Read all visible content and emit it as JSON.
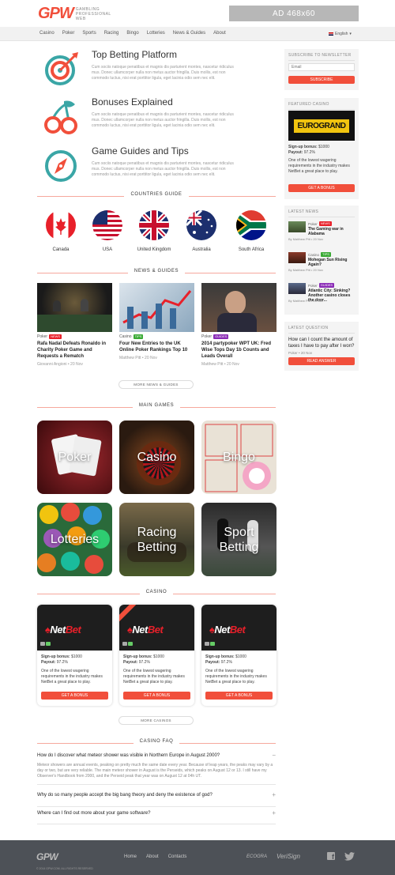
{
  "header": {
    "logo_mark": "GPW",
    "logo_text_lines": [
      "GAMBLING",
      "PROFESSIONAL",
      "WEB"
    ],
    "ad_label": "AD 468x60"
  },
  "nav": {
    "items": [
      "Casino",
      "Poker",
      "Sports",
      "Racing",
      "Bingo",
      "Lotteries",
      "News & Guides",
      "About"
    ],
    "language": "English"
  },
  "features": [
    {
      "title": "Top Betting Platform",
      "icon": "target-icon",
      "text": "Cum sociis natoque penatibus et magnis dis parturient montes, nascetur ridiculus mus. Donec ullamcorper nulla non metus auctor fringilla. Duis mollis, est non commodo luctus, nisi erat porttitor ligula, eget lacinia odio sem nec elit."
    },
    {
      "title": "Bonuses Explained",
      "icon": "cherries-icon",
      "text": "Cum sociis natoque penatibus et magnis dis parturient montes, nascetur ridiculus mus. Donec ullamcorper nulla non metus auctor fringilla. Duis mollis, est non commodo luctus, nisi erat porttitor ligula, eget lacinia odio sem nec elit."
    },
    {
      "title": "Game Guides and Tips",
      "icon": "compass-icon",
      "text": "Cum sociis natoque penatibus et magnis dis parturient montes, nascetur ridiculus mus. Donec ullamcorper nulla non metus auctor fringilla. Duis mollis, est non commodo luctus, nisi erat porttitor ligula, eget lacinia odio sem nec elit."
    }
  ],
  "countries": {
    "heading": "COUNTRIES GUIDE",
    "items": [
      "Canada",
      "USA",
      "United Kingdom",
      "Australia",
      "South Africa"
    ]
  },
  "news": {
    "heading": "NEWS & GUIDES",
    "more_label": "MORE NEWS & GUIDES",
    "items": [
      {
        "category": "Poker",
        "badge": "NEWS",
        "title": "Rafa Nadal Defeats Ronaldo in Charity Poker Game and Requests a Rematch",
        "byline": "Giovanni Angioni • 20 Nov"
      },
      {
        "category": "Casino",
        "badge": "TIPS",
        "title": "Four New Entries to the UK Online Poker Rankings Top 10",
        "byline": "Matthew Pitt • 20 Nov"
      },
      {
        "category": "Poker",
        "badge": "GUIDES",
        "title": "2014 partypoker WPT UK: Fred Wise Tops Day 1b Counts and Leads Overall",
        "byline": "Matthew Pitt • 20 Nov"
      }
    ]
  },
  "games": {
    "heading": "MAIN GAMES",
    "items": [
      "Poker",
      "Casino",
      "Bingo",
      "Lotteries",
      "Racing Betting",
      "Sport Betting"
    ]
  },
  "casino": {
    "heading": "CASINO",
    "more_label": "MORE CASINOS",
    "cards": [
      {
        "brand_a": "Net",
        "brand_b": "Bet",
        "bonus_label": "Sign-up bonus:",
        "bonus": "$1000",
        "payout_label": "Payout:",
        "payout": "97.2%",
        "text": "One of the lowest wagering requirements in the industry makes NetBet a great place to play.",
        "button": "GET A BONUS"
      },
      {
        "brand_a": "Net",
        "brand_b": "Bet",
        "bonus_label": "Sign-up bonus:",
        "bonus": "$1000",
        "payout_label": "Payout:",
        "payout": "97.2%",
        "text": "One of the lowest wagering requirements in the industry makes NetBet a great place to play.",
        "button": "GET A BONUS"
      },
      {
        "brand_a": "Net",
        "brand_b": "Bet",
        "bonus_label": "Sign-up bonus:",
        "bonus": "$1000",
        "payout_label": "Payout:",
        "payout": "97.2%",
        "text": "One of the lowest wagering requirements in the industry makes NetBet a great place to play.",
        "button": "GET A BONUS"
      }
    ]
  },
  "faq": {
    "heading": "CASINO FAQ",
    "items": [
      {
        "q": "How do I discover what meteor shower was visible in Northern Europe in August 2000?",
        "toggle": "−",
        "a": "Meteor showers are annual events, peaking on pretty much the same date every year. Because of leap years, the peaks may vary by a day or two, but are very reliable. The main meteor shower in August is the Perseids, which peaks on August 12 or 13. I still have my Observer's Handbook from 2000, and the Perseid peak that year was on August 12 at 04h UT."
      },
      {
        "q": "Why do so many people accept the big bang theory and deny the existence of god?",
        "toggle": "+"
      },
      {
        "q": "Where can I find out more about your game software?",
        "toggle": "+"
      }
    ]
  },
  "sidebar": {
    "newsletter": {
      "title": "SUBSCRIBE TO NEWSLETTER",
      "placeholder": "Email",
      "button": "SUBSCRIBE"
    },
    "featured": {
      "title": "FEATURED CASINO",
      "logo_a": "EURO",
      "logo_b": "GRAND",
      "bonus_label": "Sign-up bonus:",
      "bonus": "$1000",
      "payout_label": "Payout:",
      "payout": "97.2%",
      "text": "One of the lowest wagering requirements in the industry makes NetBet a great place to play.",
      "button": "GET A BONUS"
    },
    "latest_news": {
      "title": "LATEST NEWS",
      "items": [
        {
          "category": "Poker",
          "badge": "NEWS",
          "title": "The Gaming war in Alabama",
          "byline": "By Matthew Pitt • 20 Nov"
        },
        {
          "category": "Casino",
          "badge": "TIPS",
          "title": "Mohegan Sun Rising Again?",
          "byline": "By Matthew Pitt • 20 Nov"
        },
        {
          "category": "Poker",
          "badge": "GUIDES",
          "title": "Atlantic City: Sinking? Another casino closes the door...",
          "byline": "By Matthew Pitt • 20 Nov"
        }
      ]
    },
    "latest_question": {
      "title": "LATEST QUESTION",
      "text": "How can I count the amount of taxes I have to pay after I won?",
      "byline": "Poker • 20 Nov",
      "button": "READ ANSWER"
    }
  },
  "footer": {
    "logo": "GPW",
    "links": [
      "Home",
      "About",
      "Contacts"
    ],
    "copyright": "© 2014 GPW.COM. ALL RIGHTS RESERVED",
    "partners": [
      "ECOGRA",
      "VeriSign"
    ]
  },
  "colors": {
    "accent": "#f14f3b",
    "teal": "#3aa6a6",
    "footer": "#4d5157",
    "badge_news": "#e8202a",
    "badge_tips": "#3aaa35",
    "badge_guides": "#8a2bb6"
  }
}
